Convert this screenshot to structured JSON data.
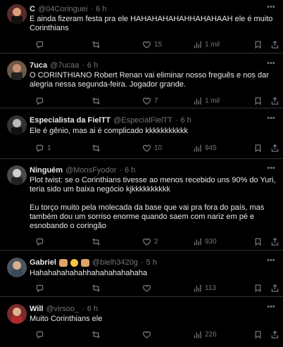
{
  "tweets": [
    {
      "name": "C",
      "handle": "@04Coringuei",
      "time": "6 h",
      "text": "E ainda fizeram festa pra ele HAHAHAHAHAHHAHAHAAH ele é muito Corinthians",
      "replies": "",
      "likes": "15",
      "views": "1 mil",
      "avatar_color": "#5a2a2a"
    },
    {
      "name": "7uca",
      "handle": "@7ucaa",
      "time": "6 h",
      "text": "O CORINTHIANO Robert Renan vai eliminar nosso freguês e nos dar alegria nessa segunda-feira. Jogador grande.",
      "replies": "",
      "likes": "7",
      "views": "1 mil",
      "avatar_color": "#6b5a4a"
    },
    {
      "name": "Especialista da FielTT",
      "handle": "@EspecialFielTT",
      "time": "6 h",
      "text": "Ele é gênio, mas ai é complicado kkkkkkkkkkk",
      "replies": "1",
      "likes": "10",
      "views": "945",
      "avatar_color": "#333333"
    },
    {
      "name": "Ninguém",
      "handle": "@MonsFyodor",
      "time": "6 h",
      "text": "Plot twist: se o Corinthians tivesse ao menos recebido uns 90% do Yuri, teria sido um baixa negócio kjkkkkkkkkkk",
      "text2": "Eu torço muito pela molecada da base que vai pra fora do país, mas também dou um sorriso enorme quando saem com nariz em pé e esnobando o coringão",
      "replies": "",
      "likes": "2",
      "views": "930",
      "avatar_color": "#4a4a4a"
    },
    {
      "name": "Gabriel",
      "handle": "@bielh3420g",
      "time": "5 h",
      "text": "Hahahahahahahhahahahahahaha",
      "replies": "",
      "likes": "",
      "views": "113",
      "avatar_color": "#4a5560"
    },
    {
      "name": "Will",
      "handle": "@virsoo_",
      "time": "6 h",
      "text": "Muito Corinthians ele",
      "replies": "",
      "likes": "",
      "views": "226",
      "avatar_color": "#7a2a2a"
    }
  ],
  "colors": {
    "background": "#000000",
    "text": "#e7e9ea",
    "secondary": "#71767b",
    "divider": "#2f3336"
  },
  "icons": {
    "reply": "reply-icon",
    "retweet": "retweet-icon",
    "like": "heart-icon",
    "views": "views-icon",
    "more": "more-icon"
  }
}
